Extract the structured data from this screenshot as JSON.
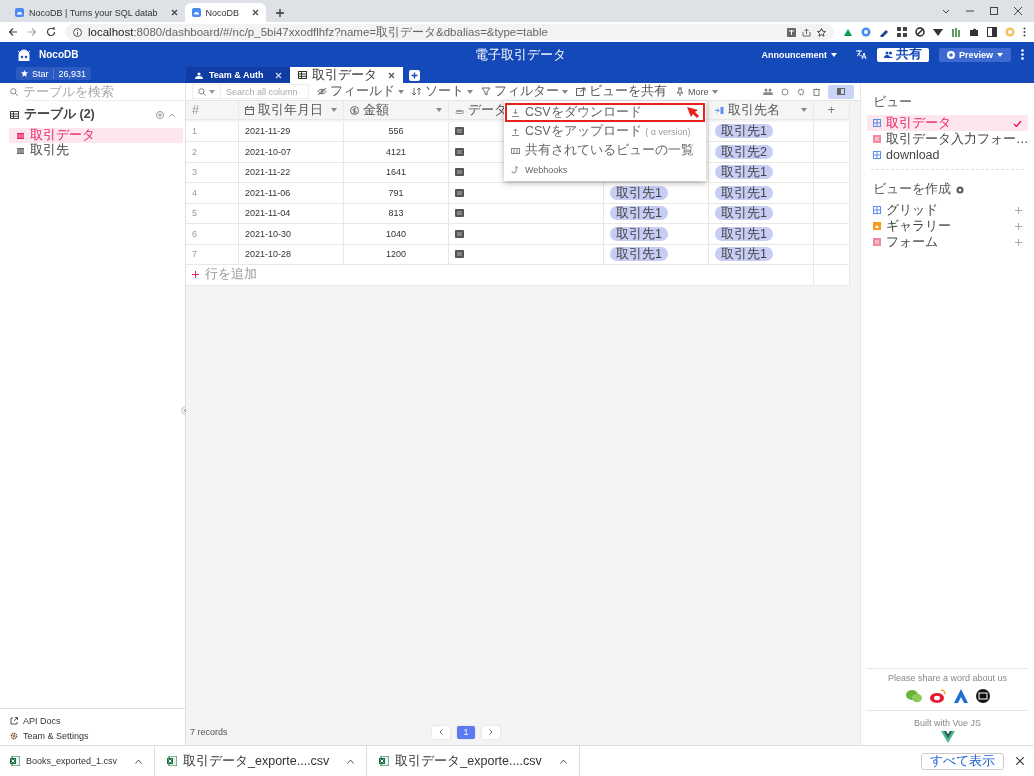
{
  "browser": {
    "tabs": [
      {
        "title": "NocoDB | Turns your SQL datab",
        "selected": false
      },
      {
        "title": "NocoDB",
        "selected": true
      }
    ],
    "url": "**localhost**:8080/dashboard/#/nc/p_5bi47xxodflhfz?name=取引データ&dbalias=&type=table"
  },
  "app": {
    "brand": "NocoDB",
    "star_label": "Star",
    "star_count": "26,931",
    "title": "電子取引データ",
    "announcement": "Announcement",
    "share": "共有",
    "preview": "Preview"
  },
  "tabs": [
    {
      "label": "Team & Auth",
      "kind": "team",
      "selected": false
    },
    {
      "label": "取引データ",
      "kind": "table",
      "selected": true
    }
  ],
  "sidebar": {
    "search_placeholder": "テーブルを検索",
    "section": "テーブル (2)",
    "items": [
      {
        "label": "取引データ",
        "selected": true
      },
      {
        "label": "取引先",
        "selected": false
      }
    ],
    "footer": [
      {
        "label": "API Docs",
        "kind": "docs"
      },
      {
        "label": "Team & Settings",
        "kind": "settings"
      }
    ]
  },
  "toolbar": {
    "search_placeholder": "Search all column",
    "buttons": [
      {
        "label": "フィールド",
        "kind": "fields"
      },
      {
        "label": "ソート",
        "kind": "sort"
      },
      {
        "label": "フィルター",
        "kind": "filter"
      },
      {
        "label": "ビューを共有",
        "kind": "share"
      },
      {
        "label": "More",
        "kind": "more"
      }
    ]
  },
  "table": {
    "columns": [
      {
        "label": "#",
        "kind": "index"
      },
      {
        "label": "取引年月日",
        "kind": "date"
      },
      {
        "label": "金額",
        "kind": "currency"
      },
      {
        "label": "データ",
        "kind": "attachment"
      },
      {
        "kind": "link"
      },
      {
        "label": "取引先名",
        "kind": "lookup"
      }
    ],
    "rows": [
      {
        "index": "1",
        "date": "2021-11-29",
        "amount": "556",
        "file": true,
        "lookup": "取引先1"
      },
      {
        "index": "2",
        "date": "2021-10-07",
        "amount": "4121",
        "file": true,
        "lookup": "取引先2"
      },
      {
        "index": "3",
        "date": "2021-11-22",
        "amount": "1641",
        "file": true,
        "lookup": "取引先1"
      },
      {
        "index": "4",
        "date": "2021-11-06",
        "amount": "791",
        "file": true,
        "link": "取引先1",
        "lookup": "取引先1"
      },
      {
        "index": "5",
        "date": "2021-11-04",
        "amount": "813",
        "file": true,
        "link": "取引先1",
        "lookup": "取引先1"
      },
      {
        "index": "6",
        "date": "2021-10-30",
        "amount": "1040",
        "file": true,
        "link": "取引先1",
        "lookup": "取引先1"
      },
      {
        "index": "7",
        "date": "2021-10-28",
        "amount": "1200",
        "file": true,
        "link": "取引先1",
        "lookup": "取引先1"
      }
    ],
    "add_column": "+",
    "add_row": "行を追加",
    "records": "7 records",
    "pages": [
      {
        "label": "1",
        "selected": true
      }
    ]
  },
  "menu": [
    {
      "label": "CSVをダウンロード",
      "kind": "download",
      "highlighted": true
    },
    {
      "label": "CSVをアップロード ( α version)",
      "kind": "upload",
      "highlighted": false
    },
    {
      "label": "共有されているビューの一覧",
      "kind": "list",
      "highlighted": false
    },
    {
      "label": "Webhooks",
      "kind": "webhook",
      "highlighted": false
    }
  ],
  "views": {
    "heading": "ビュー",
    "items": [
      {
        "label": "取引データ",
        "kind": "grid",
        "selected": true
      },
      {
        "label": "取引データ入力フォー…",
        "kind": "form",
        "selected": false
      },
      {
        "label": "download",
        "kind": "grid",
        "selected": false
      }
    ],
    "create_heading": "ビューを作成",
    "create": [
      {
        "label": "グリッド",
        "kind": "grid"
      },
      {
        "label": "ギャラリー",
        "kind": "gallery"
      },
      {
        "label": "フォーム",
        "kind": "form"
      }
    ],
    "share_text": "Please share a word about us",
    "built_with": "Built with Vue JS"
  },
  "downloads": {
    "items": [
      "Books_exported_1.csv",
      "取引データ_exporte....csv",
      "取引データ_exporte....csv"
    ],
    "show_all": "すべて表示"
  }
}
